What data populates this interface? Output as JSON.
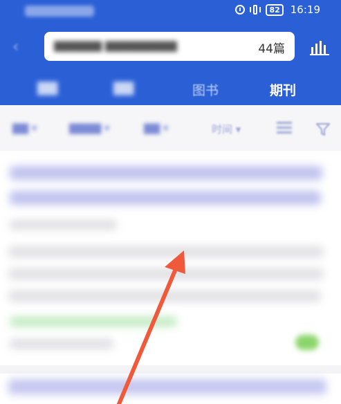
{
  "status_bar": {
    "battery": "82",
    "time": "16:19"
  },
  "search": {
    "count": "44篇"
  },
  "tabs": [
    {
      "label": "图书"
    },
    {
      "label": "期刊"
    }
  ],
  "filters": {
    "time_label": "时间"
  },
  "colors": {
    "header_blue": "#2a5fd6",
    "arrow_red": "#ef5a3d"
  }
}
